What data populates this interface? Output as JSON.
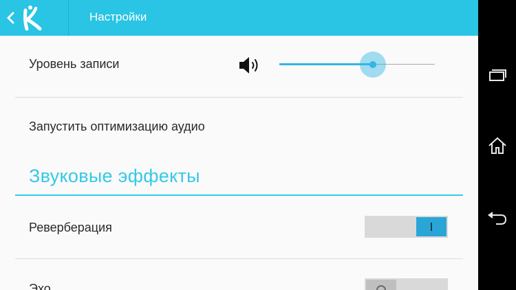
{
  "action_bar": {
    "title": "Настройки",
    "up_icon": "chevron-left-icon",
    "logo_icon": "app-logo-icon",
    "color": "#2ac4e4"
  },
  "prefs": {
    "record_level": {
      "label": "Уровень записи",
      "icon": "speaker-icon",
      "value": 0.6
    },
    "optimize_audio": {
      "label": "Запустить оптимизацию аудио"
    }
  },
  "section": {
    "title": "Звуковые эффекты",
    "color": "#33c9e8"
  },
  "effects": {
    "reverb": {
      "label": "Реверберация",
      "on": true
    },
    "echo": {
      "label": "Эхо",
      "on": false
    }
  },
  "nav": {
    "recents_icon": "recent-apps-icon",
    "home_icon": "home-icon",
    "back_icon": "back-icon"
  },
  "colors": {
    "accent": "#33b5e5",
    "toggle_on": "#2aa6d6"
  }
}
